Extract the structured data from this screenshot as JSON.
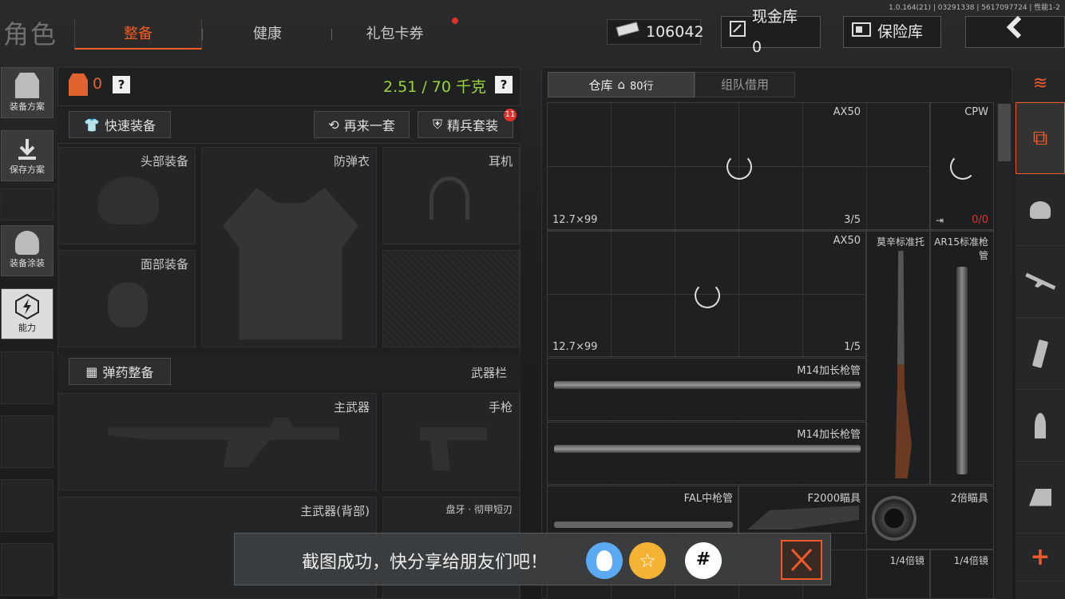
{
  "version": "1.0.164(21) | 03291338 | 5617097724 | 性能1-2",
  "page_title": "角色",
  "tabs": [
    {
      "label": "整备",
      "active": true
    },
    {
      "label": "健康"
    },
    {
      "label": "礼包卡券",
      "badge": true
    }
  ],
  "currency": {
    "value": "106042",
    "icon": "cash-icon"
  },
  "cash_vault": {
    "label": "现金库 0"
  },
  "safe": {
    "label": "保险库"
  },
  "back": {
    "icon": "back-arrow-icon"
  },
  "sidebar": [
    {
      "label": "装备方案",
      "icon": "vest-icon"
    },
    {
      "label": "保存方案",
      "icon": "download-icon"
    },
    {
      "label": "装备涂装",
      "icon": "helmet-paint-icon"
    },
    {
      "label": "能力",
      "icon": "ability-icon"
    }
  ],
  "loadout": {
    "armor_count": "0",
    "weight": "2.51 / 70 千克",
    "quick_equip": "快速装备",
    "redo": "再来一套",
    "elite": "精兵套装",
    "elite_badge": "11",
    "slots": {
      "head": "头部装备",
      "armor": "防弹衣",
      "headset": "耳机",
      "face": "面部装备"
    },
    "ammo_btn": "弹药整备",
    "weapon_bar": "武器栏",
    "weapons": {
      "primary": "主武器",
      "pistol": "手枪",
      "primary_back": "主武器(背部)",
      "melee": "盘牙 · 彻甲短刃"
    }
  },
  "warehouse": {
    "tab_label": "仓库",
    "rows": "80行",
    "team_label": "组队借用",
    "items": [
      {
        "name": "AX50",
        "sub": "12.7×99",
        "count": "3/5"
      },
      {
        "name": "CPW",
        "count_a": "0",
        "count_b": "/0"
      },
      {
        "name": "AX50",
        "sub": "12.7×99",
        "count": "1/5"
      },
      {
        "name": "莫辛标准托"
      },
      {
        "name": "AR15标准枪管"
      },
      {
        "name": "M14加长枪管"
      },
      {
        "name": "M14加长枪管"
      },
      {
        "name": "FAL中枪管"
      },
      {
        "name": "F2000瞄具"
      },
      {
        "name": "2倍瞄具"
      },
      {
        "name": "1/4倍镜"
      },
      {
        "name": "1/4倍镜"
      }
    ]
  },
  "rightbar": [
    {
      "icon": "layers-refresh-icon"
    },
    {
      "icon": "stack-download-icon",
      "active": true
    },
    {
      "icon": "helmet-icon"
    },
    {
      "icon": "rifle-icon"
    },
    {
      "icon": "magazine-icon"
    },
    {
      "icon": "bullet-icon"
    },
    {
      "icon": "scope-icon"
    },
    {
      "icon": "plus-icon"
    }
  ],
  "toast": {
    "text": "截图成功，快分享给朋友们吧！"
  }
}
